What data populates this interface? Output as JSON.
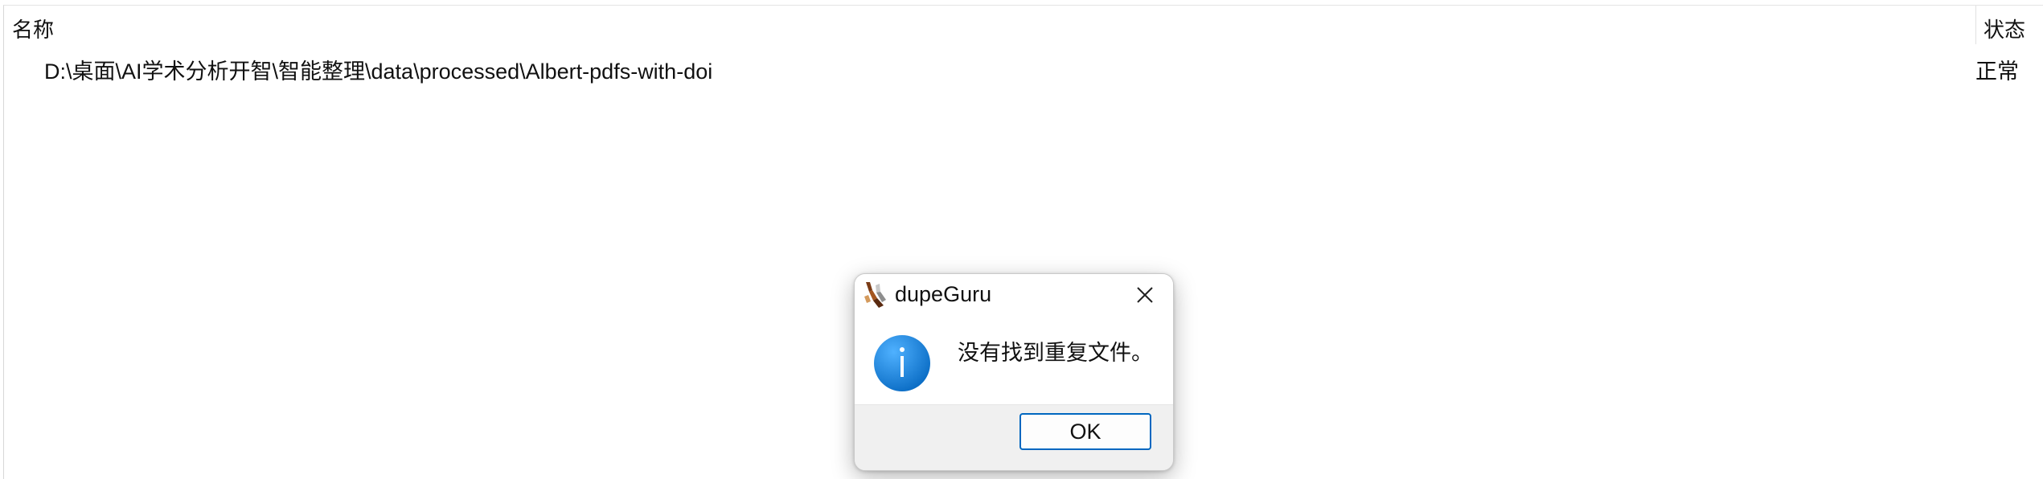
{
  "list": {
    "columns": {
      "name": "名称",
      "status": "状态"
    },
    "rows": [
      {
        "path": "D:\\桌面\\AI学术分析开智\\智能整理\\data\\processed\\Albert-pdfs-with-doi",
        "status": "正常"
      }
    ]
  },
  "dialog": {
    "title": "dupeGuru",
    "message": "没有找到重复文件。",
    "ok_label": "OK",
    "icons": {
      "app": "dupeguru-app-icon",
      "close": "close-icon",
      "info": "info-icon"
    },
    "colors": {
      "info_blue": "#1a7fd8",
      "button_border": "#0067c0"
    }
  }
}
